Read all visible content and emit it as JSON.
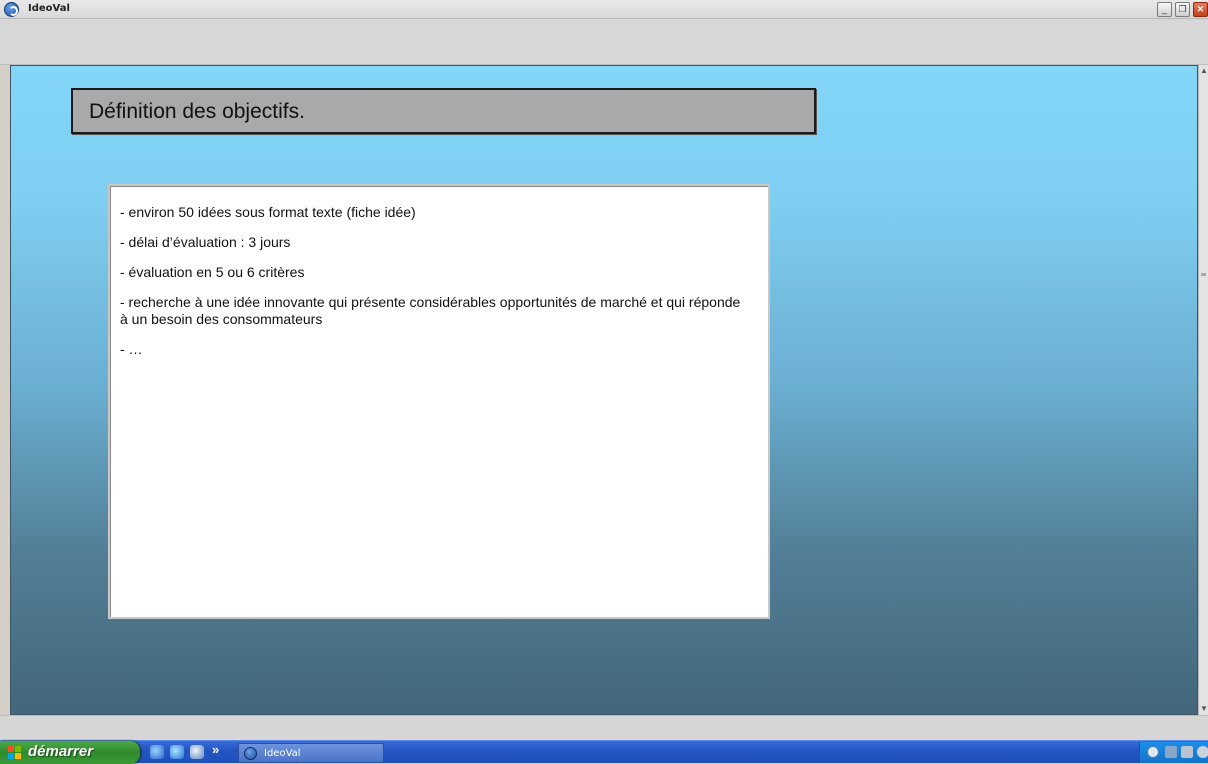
{
  "window": {
    "title": "IdeoVal",
    "min_glyph": "_",
    "max_glyph": "❐",
    "close_glyph": "✕"
  },
  "slide": {
    "heading": "Définition des objectifs.",
    "bullets": [
      "- environ 50 idées sous format texte (fiche idée)",
      "- délai d’évaluation : 3 jours",
      "- évaluation en 5 ou 6 critères",
      "- recherche à une idée innovante qui présente considérables opportunités de marché et qui réponde à un besoin des consommateurs",
      "- …"
    ]
  },
  "scrollbar": {
    "up_glyph": "▲",
    "down_glyph": "▼"
  },
  "taskbar": {
    "start_label": "démarrer",
    "more_glyph": "»",
    "task_label": "IdeoVal"
  },
  "colors": {
    "titlebar": "#d9d9d9",
    "content_top": "#82d6f8",
    "content_bottom": "#43667a",
    "heading_box": "#a8a9a8",
    "taskbar": "#2456c4",
    "start_button": "#3a9a36"
  }
}
